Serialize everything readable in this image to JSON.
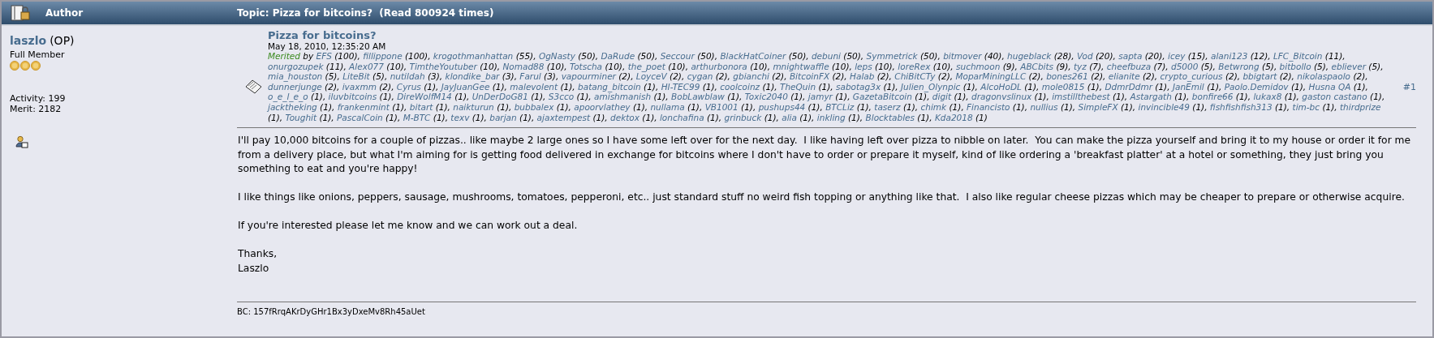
{
  "header": {
    "author_label": "Author",
    "topic": "Topic: Pizza for bitcoins?  (Read 800924 times)"
  },
  "author": {
    "name": "laszlo",
    "tag": "(OP)",
    "rank": "Full Member",
    "stars": 3,
    "activity": "Activity: 199",
    "merit": "Merit: 2182"
  },
  "post": {
    "title": "Pizza for bitcoins?",
    "date": "May 18, 2010, 12:35:20 AM",
    "merited_label": "Merited",
    "by": "by",
    "number": "#1",
    "merits": [
      {
        "user": "EFS",
        "points": "(100),"
      },
      {
        "user": "fillippone",
        "points": "(100),"
      },
      {
        "user": "krogothmanhattan",
        "points": "(55),"
      },
      {
        "user": "OgNasty",
        "points": "(50),"
      },
      {
        "user": "DaRude",
        "points": "(50),"
      },
      {
        "user": "Seccour",
        "points": "(50),"
      },
      {
        "user": "BlackHatCoiner",
        "points": "(50),"
      },
      {
        "user": "debuni",
        "points": "(50),"
      },
      {
        "user": "Symmetrick",
        "points": "(50),"
      },
      {
        "user": "bitmover",
        "points": "(40),"
      },
      {
        "user": "hugeblack",
        "points": "(28),"
      },
      {
        "user": "Vod",
        "points": "(20),"
      },
      {
        "user": "sapta",
        "points": "(20),"
      },
      {
        "user": "icey",
        "points": "(15),"
      },
      {
        "user": "alani123",
        "points": "(12),"
      },
      {
        "user": "LFC_Bitcoin",
        "points": "(11),"
      },
      {
        "user": "onurgozupek",
        "points": "(11),"
      },
      {
        "user": "Alex077",
        "points": "(10),"
      },
      {
        "user": "TimtheYoutuber",
        "points": "(10),"
      },
      {
        "user": "Nomad88",
        "points": "(10),"
      },
      {
        "user": "Totscha",
        "points": "(10),"
      },
      {
        "user": "the_poet",
        "points": "(10),"
      },
      {
        "user": "arthurbonora",
        "points": "(10),"
      },
      {
        "user": "mnightwaffle",
        "points": "(10),"
      },
      {
        "user": "leps",
        "points": "(10),"
      },
      {
        "user": "loreRex",
        "points": "(10),"
      },
      {
        "user": "suchmoon",
        "points": "(9),"
      },
      {
        "user": "ABCbits",
        "points": "(9),"
      },
      {
        "user": "tyz",
        "points": "(7),"
      },
      {
        "user": "cheefbuza",
        "points": "(7),"
      },
      {
        "user": "d5000",
        "points": "(5),"
      },
      {
        "user": "Betwrong",
        "points": "(5),"
      },
      {
        "user": "bitbollo",
        "points": "(5),"
      },
      {
        "user": "ebliever",
        "points": "(5),"
      },
      {
        "user": "mia_houston",
        "points": "(5),"
      },
      {
        "user": "LiteBit",
        "points": "(5),"
      },
      {
        "user": "nutildah",
        "points": "(3),"
      },
      {
        "user": "klondike_bar",
        "points": "(3),"
      },
      {
        "user": "Farul",
        "points": "(3),"
      },
      {
        "user": "vapourminer",
        "points": "(2),"
      },
      {
        "user": "LoyceV",
        "points": "(2),"
      },
      {
        "user": "cygan",
        "points": "(2),"
      },
      {
        "user": "gbianchi",
        "points": "(2),"
      },
      {
        "user": "BitcoinFX",
        "points": "(2),"
      },
      {
        "user": "Halab",
        "points": "(2),"
      },
      {
        "user": "ChiBitCTy",
        "points": "(2),"
      },
      {
        "user": "MoparMiningLLC",
        "points": "(2),"
      },
      {
        "user": "bones261",
        "points": "(2),"
      },
      {
        "user": "elianite",
        "points": "(2),"
      },
      {
        "user": "crypto_curious",
        "points": "(2),"
      },
      {
        "user": "bbigtart",
        "points": "(2),"
      },
      {
        "user": "nikolaspaolo",
        "points": "(2),"
      },
      {
        "user": "dunnerjunge",
        "points": "(2),"
      },
      {
        "user": "ivaxmm",
        "points": "(2),"
      },
      {
        "user": "Cyrus",
        "points": "(1),"
      },
      {
        "user": "JayJuanGee",
        "points": "(1),"
      },
      {
        "user": "malevolent",
        "points": "(1),"
      },
      {
        "user": "batang_bitcoin",
        "points": "(1),"
      },
      {
        "user": "HI-TEC99",
        "points": "(1),"
      },
      {
        "user": "coolcoinz",
        "points": "(1),"
      },
      {
        "user": "TheQuin",
        "points": "(1),"
      },
      {
        "user": "sabotag3x",
        "points": "(1),"
      },
      {
        "user": "Julien_Olynpic",
        "points": "(1),"
      },
      {
        "user": "AlcoHoDL",
        "points": "(1),"
      },
      {
        "user": "mole0815",
        "points": "(1),"
      },
      {
        "user": "DdmrDdmr",
        "points": "(1),"
      },
      {
        "user": "JanEmil",
        "points": "(1),"
      },
      {
        "user": "Paolo.Demidov",
        "points": "(1),"
      },
      {
        "user": "Husna QA",
        "points": "(1),"
      },
      {
        "user": "o_e_l_e_o",
        "points": "(1),"
      },
      {
        "user": "iluvbitcoins",
        "points": "(1),"
      },
      {
        "user": "DireWolfM14",
        "points": "(1),"
      },
      {
        "user": "UnDerDoG81",
        "points": "(1),"
      },
      {
        "user": "S3cco",
        "points": "(1),"
      },
      {
        "user": "amishmanish",
        "points": "(1),"
      },
      {
        "user": "BobLawblaw",
        "points": "(1),"
      },
      {
        "user": "Toxic2040",
        "points": "(1),"
      },
      {
        "user": "jamyr",
        "points": "(1),"
      },
      {
        "user": "GazetaBitcoin",
        "points": "(1),"
      },
      {
        "user": "digit",
        "points": "(1),"
      },
      {
        "user": "dragonvslinux",
        "points": "(1),"
      },
      {
        "user": "imstillthebest",
        "points": "(1),"
      },
      {
        "user": "Astargath",
        "points": "(1),"
      },
      {
        "user": "bonfire66",
        "points": "(1),"
      },
      {
        "user": "lukax8",
        "points": "(1),"
      },
      {
        "user": "gaston castano",
        "points": "(1),"
      },
      {
        "user": "jacktheking",
        "points": "(1),"
      },
      {
        "user": "frankenmint",
        "points": "(1),"
      },
      {
        "user": "bitart",
        "points": "(1),"
      },
      {
        "user": "naikturun",
        "points": "(1),"
      },
      {
        "user": "bubbalex",
        "points": "(1),"
      },
      {
        "user": "apoorvlathey",
        "points": "(1),"
      },
      {
        "user": "nullama",
        "points": "(1),"
      },
      {
        "user": "VB1001",
        "points": "(1),"
      },
      {
        "user": "pushups44",
        "points": "(1),"
      },
      {
        "user": "BTCLiz",
        "points": "(1),"
      },
      {
        "user": "taserz",
        "points": "(1),"
      },
      {
        "user": "chimk",
        "points": "(1),"
      },
      {
        "user": "Financisto",
        "points": "(1),"
      },
      {
        "user": "nullius",
        "points": "(1),"
      },
      {
        "user": "SimpleFX",
        "points": "(1),"
      },
      {
        "user": "invincible49",
        "points": "(1),"
      },
      {
        "user": "fishfishfish313",
        "points": "(1),"
      },
      {
        "user": "tim-bc",
        "points": "(1),"
      },
      {
        "user": "thirdprize",
        "points": "(1),"
      },
      {
        "user": "Toughit",
        "points": "(1),"
      },
      {
        "user": "PascalCoin",
        "points": "(1),"
      },
      {
        "user": "M-BTC",
        "points": "(1),"
      },
      {
        "user": "texv",
        "points": "(1),"
      },
      {
        "user": "barjan",
        "points": "(1),"
      },
      {
        "user": "ajaxtempest",
        "points": "(1),"
      },
      {
        "user": "dektox",
        "points": "(1),"
      },
      {
        "user": "lonchafina",
        "points": "(1),"
      },
      {
        "user": "grinbuck",
        "points": "(1),"
      },
      {
        "user": "alia",
        "points": "(1),"
      },
      {
        "user": "inkling",
        "points": "(1),"
      },
      {
        "user": "Blocktables",
        "points": "(1),"
      },
      {
        "user": "Kda2018",
        "points": "(1)"
      }
    ],
    "paragraphs": [
      "I'll pay 10,000 bitcoins for a couple of pizzas.. like maybe 2 large ones so I have some left over for the next day.  I like having left over pizza to nibble on later.  You can make the pizza yourself and bring it to my house or order it for me from a delivery place, but what I'm aiming for is getting food delivered in exchange for bitcoins where I don't have to order or prepare it myself, kind of like ordering a 'breakfast platter' at a hotel or something, they just bring you something to eat and you're happy!",
      "I like things like onions, peppers, sausage, mushrooms, tomatoes, pepperoni, etc.. just standard stuff no weird fish topping or anything like that.  I also like regular cheese pizzas which may be cheaper to prepare or otherwise acquire.",
      "If you're interested please let me know and we can work out a deal.",
      "Thanks,\nLaszlo"
    ],
    "signature": "BC: 157fRrqAKrDyGHr1Bx3yDxeMv8Rh45aUet"
  }
}
